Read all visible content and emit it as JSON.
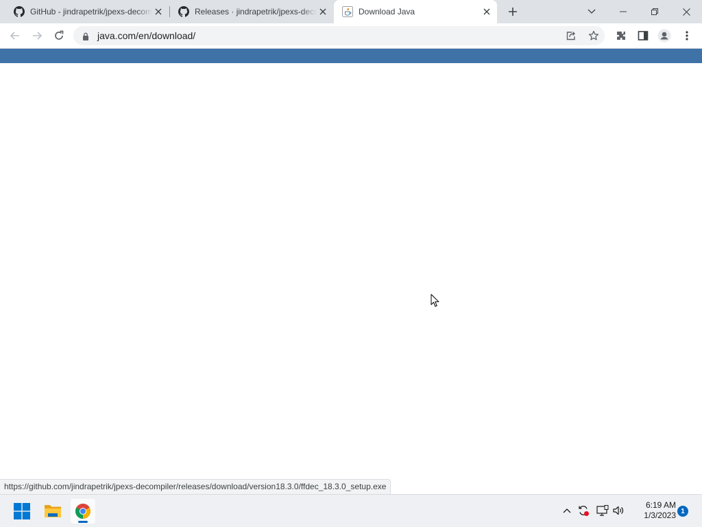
{
  "browser": {
    "tabs": [
      {
        "title": "GitHub - jindrapetrik/jpexs-decompiler",
        "icon": "github-icon",
        "active": false
      },
      {
        "title": "Releases · jindrapetrik/jpexs-decompiler",
        "icon": "github-icon",
        "active": false
      },
      {
        "title": "Download Java",
        "icon": "java-icon",
        "active": true
      }
    ],
    "new_tab_icon": "plus-icon",
    "window_controls": [
      "tab-search-icon",
      "minimize-icon",
      "restore-icon",
      "close-icon"
    ],
    "toolbar": {
      "back_icon": "back-arrow-icon",
      "forward_icon": "forward-arrow-icon",
      "reload_icon": "reload-icon",
      "url": "java.com/en/download/",
      "omnibox_icons": [
        "share-icon",
        "star-icon"
      ],
      "right_icons": [
        "extensions-icon",
        "side-panel-icon",
        "profile-icon",
        "menu-icon"
      ]
    }
  },
  "page": {
    "banner_color": "#3f73a8",
    "status_url": "https://github.com/jindrapetrik/jpexs-decompiler/releases/download/version18.3.0/ffdec_18.3.0_setup.exe"
  },
  "taskbar": {
    "apps": [
      "windows-start-icon",
      "file-explorer-icon",
      "chrome-icon"
    ],
    "tray_icons": [
      "chevron-up-icon",
      "sync-icon",
      "network-icon",
      "volume-icon"
    ],
    "time": "6:19 AM",
    "date": "1/3/2023",
    "notification_count": "1"
  }
}
